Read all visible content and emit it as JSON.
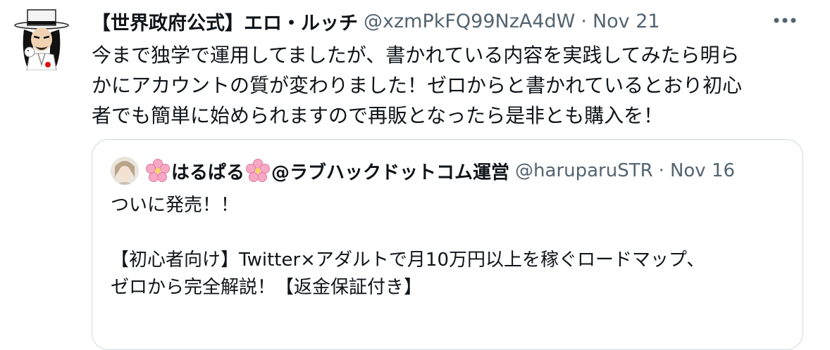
{
  "tweet": {
    "author_name": "【世界政府公式】エロ・ルッチ",
    "author_handle": "@xzmPkFQ99NzA4dW",
    "separator": "·",
    "date": "Nov 21",
    "body_lines": [
      "今まで独学で運用してましたが、書かれている内容を実践してみたら明ら",
      "かにアカウントの質が変わりました！ゼロからと書かれているとおり初心",
      "者でも簡単に始められますので再販となったら是非とも購入を！"
    ]
  },
  "quoted_tweet": {
    "author_name": "はるぱる",
    "author_name_suffix": "@ラブハックドットコム運営",
    "author_handle": "@haruparuSTR",
    "separator": "·",
    "date": "Nov 16",
    "body_line1": "ついに発売！！",
    "body_line2": "【初心者向け】Twitter×アダルトで月10万円以上を稼ぐロードマップ、",
    "body_line3": "ゼロから完全解説！【返金保証付き】"
  },
  "icons": {
    "more": "more-options-icon",
    "flower": "cherry-blossom-icon"
  },
  "colors": {
    "text_primary": "#0f1419",
    "text_secondary": "#536471",
    "border": "#cfd9de"
  }
}
